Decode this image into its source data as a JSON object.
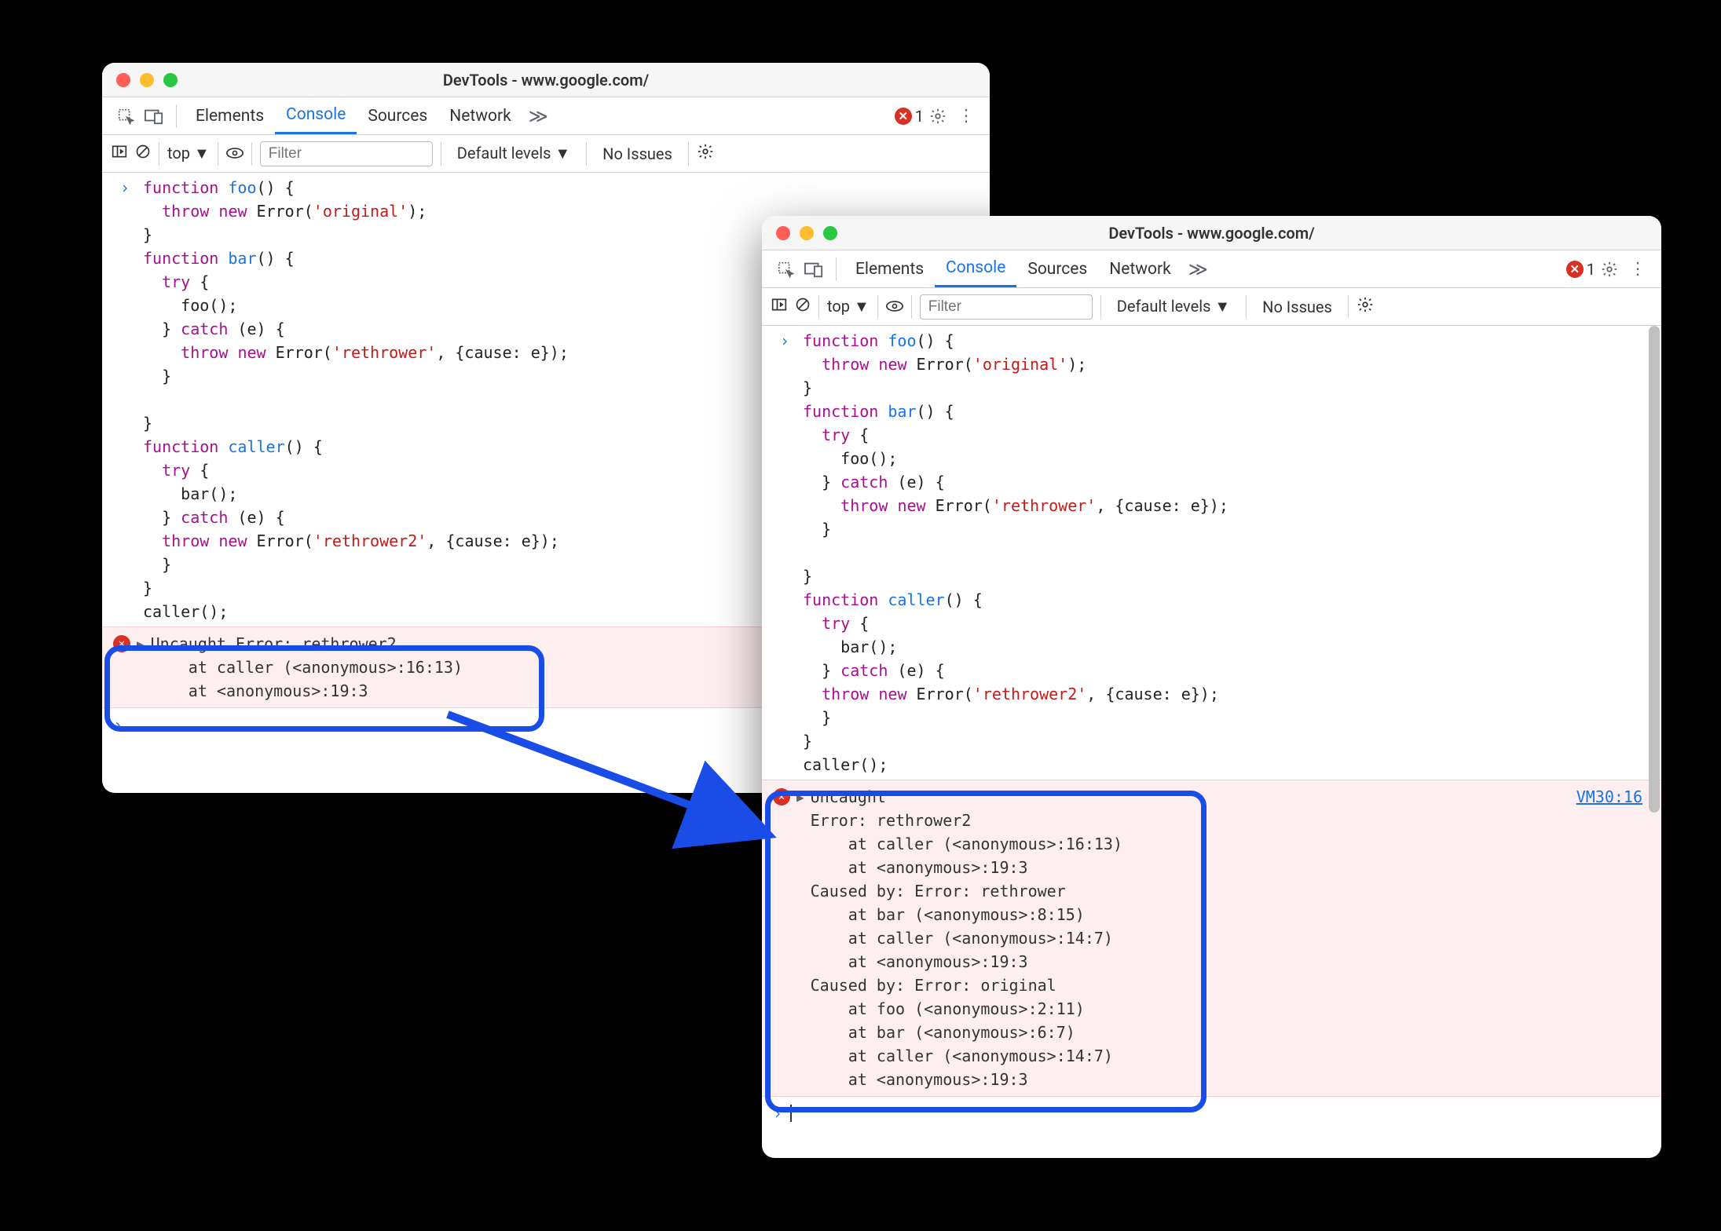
{
  "window1": {
    "title": "DevTools - www.google.com/",
    "tabs": [
      "Elements",
      "Console",
      "Sources",
      "Network"
    ],
    "active_tab": "Console",
    "error_count": "1",
    "toolbar": {
      "context": "top",
      "filter_placeholder": "Filter",
      "levels": "Default levels",
      "issues": "No Issues"
    },
    "code_lines": [
      [
        {
          "c": "kw",
          "t": "function"
        },
        {
          "c": "plain",
          "t": " "
        },
        {
          "c": "fn",
          "t": "foo"
        },
        {
          "c": "plain",
          "t": "() {"
        }
      ],
      [
        {
          "c": "plain",
          "t": "  "
        },
        {
          "c": "kw",
          "t": "throw"
        },
        {
          "c": "plain",
          "t": " "
        },
        {
          "c": "kw",
          "t": "new"
        },
        {
          "c": "plain",
          "t": " Error("
        },
        {
          "c": "str",
          "t": "'original'"
        },
        {
          "c": "plain",
          "t": ");"
        }
      ],
      [
        {
          "c": "plain",
          "t": "}"
        }
      ],
      [
        {
          "c": "kw",
          "t": "function"
        },
        {
          "c": "plain",
          "t": " "
        },
        {
          "c": "fn",
          "t": "bar"
        },
        {
          "c": "plain",
          "t": "() {"
        }
      ],
      [
        {
          "c": "plain",
          "t": "  "
        },
        {
          "c": "kw",
          "t": "try"
        },
        {
          "c": "plain",
          "t": " {"
        }
      ],
      [
        {
          "c": "plain",
          "t": "    foo();"
        }
      ],
      [
        {
          "c": "plain",
          "t": "  } "
        },
        {
          "c": "kw",
          "t": "catch"
        },
        {
          "c": "plain",
          "t": " (e) {"
        }
      ],
      [
        {
          "c": "plain",
          "t": "    "
        },
        {
          "c": "kw",
          "t": "throw"
        },
        {
          "c": "plain",
          "t": " "
        },
        {
          "c": "kw",
          "t": "new"
        },
        {
          "c": "plain",
          "t": " Error("
        },
        {
          "c": "str",
          "t": "'rethrower'"
        },
        {
          "c": "plain",
          "t": ", {cause: e});"
        }
      ],
      [
        {
          "c": "plain",
          "t": "  }"
        }
      ],
      [
        {
          "c": "plain",
          "t": ""
        }
      ],
      [
        {
          "c": "plain",
          "t": "}"
        }
      ],
      [
        {
          "c": "kw",
          "t": "function"
        },
        {
          "c": "plain",
          "t": " "
        },
        {
          "c": "fn",
          "t": "caller"
        },
        {
          "c": "plain",
          "t": "() {"
        }
      ],
      [
        {
          "c": "plain",
          "t": "  "
        },
        {
          "c": "kw",
          "t": "try"
        },
        {
          "c": "plain",
          "t": " {"
        }
      ],
      [
        {
          "c": "plain",
          "t": "    bar();"
        }
      ],
      [
        {
          "c": "plain",
          "t": "  } "
        },
        {
          "c": "kw",
          "t": "catch"
        },
        {
          "c": "plain",
          "t": " (e) {"
        }
      ],
      [
        {
          "c": "plain",
          "t": "  "
        },
        {
          "c": "kw",
          "t": "throw"
        },
        {
          "c": "plain",
          "t": " "
        },
        {
          "c": "kw",
          "t": "new"
        },
        {
          "c": "plain",
          "t": " Error("
        },
        {
          "c": "str",
          "t": "'rethrower2'"
        },
        {
          "c": "plain",
          "t": ", {cause: e});"
        }
      ],
      [
        {
          "c": "plain",
          "t": "  }"
        }
      ],
      [
        {
          "c": "plain",
          "t": "}"
        }
      ],
      [
        {
          "c": "plain",
          "t": "caller();"
        }
      ]
    ],
    "error_text": "Uncaught Error: rethrower2\n    at caller (<anonymous>:16:13)\n    at <anonymous>:19:3"
  },
  "window2": {
    "title": "DevTools - www.google.com/",
    "tabs": [
      "Elements",
      "Console",
      "Sources",
      "Network"
    ],
    "active_tab": "Console",
    "error_count": "1",
    "toolbar": {
      "context": "top",
      "filter_placeholder": "Filter",
      "levels": "Default levels",
      "issues": "No Issues"
    },
    "error_src_link": "VM30:16",
    "error_text": "Uncaught\nError: rethrower2\n    at caller (<anonymous>:16:13)\n    at <anonymous>:19:3\nCaused by: Error: rethrower\n    at bar (<anonymous>:8:15)\n    at caller (<anonymous>:14:7)\n    at <anonymous>:19:3\nCaused by: Error: original\n    at foo (<anonymous>:2:11)\n    at bar (<anonymous>:6:7)\n    at caller (<anonymous>:14:7)\n    at <anonymous>:19:3"
  }
}
